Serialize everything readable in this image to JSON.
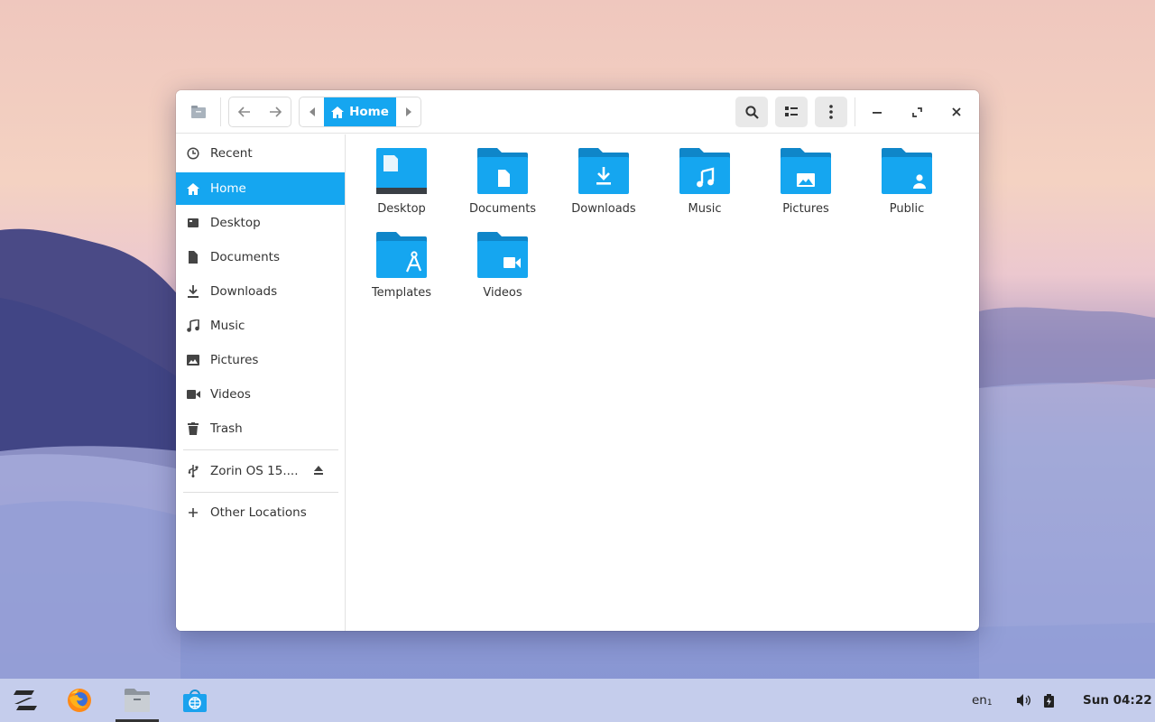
{
  "colors": {
    "accent": "#15a6f0",
    "folder": "#15a6f0",
    "folder_tab": "#0f86c9"
  },
  "headerbar": {
    "app_icon": "file-cabinet-icon",
    "back_icon": "arrow-left-icon",
    "forward_icon": "arrow-right-icon",
    "path_current": "Home",
    "search_icon": "search-icon",
    "view_icon": "list-view-icon",
    "menu_icon": "kebab-menu-icon",
    "minimize_icon": "minimize-icon",
    "maximize_icon": "maximize-icon",
    "close_icon": "close-icon"
  },
  "sidebar": {
    "items": [
      {
        "label": "Recent",
        "icon": "clock-icon"
      },
      {
        "label": "Home",
        "icon": "home-icon",
        "active": true
      },
      {
        "label": "Desktop",
        "icon": "desktop-icon"
      },
      {
        "label": "Documents",
        "icon": "document-icon"
      },
      {
        "label": "Downloads",
        "icon": "download-icon"
      },
      {
        "label": "Music",
        "icon": "music-icon"
      },
      {
        "label": "Pictures",
        "icon": "picture-icon"
      },
      {
        "label": "Videos",
        "icon": "video-icon"
      },
      {
        "label": "Trash",
        "icon": "trash-icon"
      }
    ],
    "devices": [
      {
        "label": "Zorin OS 15....",
        "icon": "usb-icon",
        "action_icon": "eject-icon"
      }
    ],
    "other_locations": {
      "label": "Other Locations",
      "icon": "plus-icon"
    }
  },
  "files": [
    {
      "label": "Desktop",
      "icon": "desktop-folder-icon"
    },
    {
      "label": "Documents",
      "icon": "documents-folder-icon"
    },
    {
      "label": "Downloads",
      "icon": "downloads-folder-icon"
    },
    {
      "label": "Music",
      "icon": "music-folder-icon"
    },
    {
      "label": "Pictures",
      "icon": "pictures-folder-icon"
    },
    {
      "label": "Public",
      "icon": "public-folder-icon"
    },
    {
      "label": "Templates",
      "icon": "templates-folder-icon"
    },
    {
      "label": "Videos",
      "icon": "videos-folder-icon"
    }
  ],
  "taskbar": {
    "apps": [
      {
        "name": "zorin-menu",
        "icon": "zorin-logo-icon"
      },
      {
        "name": "firefox",
        "icon": "firefox-icon"
      },
      {
        "name": "files",
        "icon": "files-icon",
        "active": true
      },
      {
        "name": "software",
        "icon": "software-store-icon"
      }
    ],
    "keyboard_layout": "en",
    "keyboard_layout_sub": "1",
    "volume_icon": "volume-icon",
    "battery_icon": "battery-charging-icon",
    "clock": "Sun 04:22"
  }
}
